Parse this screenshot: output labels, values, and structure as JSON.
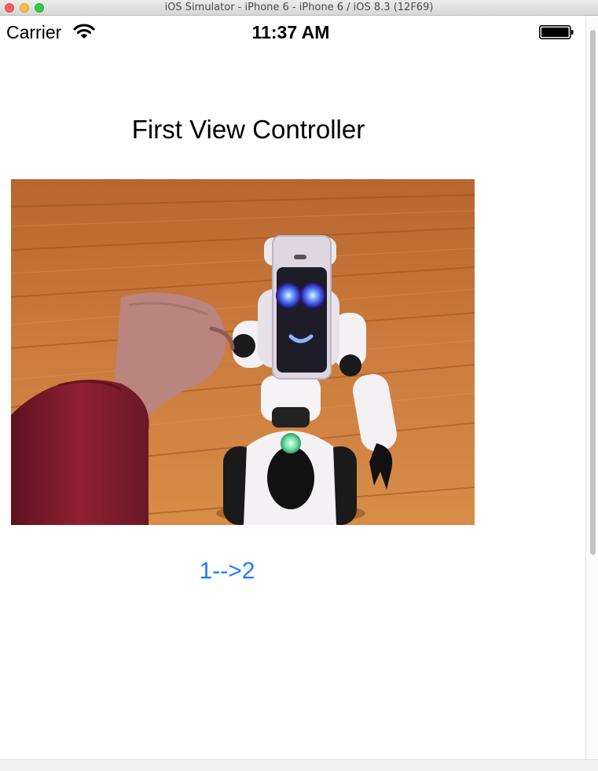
{
  "window": {
    "title": "iOS Simulator - iPhone 6 - iPhone 6 / iOS 8.3 (12F69)"
  },
  "status_bar": {
    "carrier": "Carrier",
    "time": "11:37 AM",
    "wifi_icon": "wifi-icon",
    "battery_icon": "battery-icon"
  },
  "screen": {
    "title": "First View Controller",
    "image": "robot-photo",
    "next_button_label": "1-->2",
    "accent_color": "#1a7ef5"
  }
}
